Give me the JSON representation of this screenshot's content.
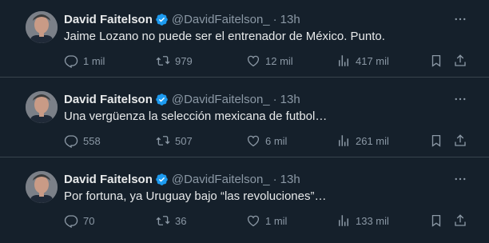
{
  "tweets": [
    {
      "name": "David Faitelson",
      "handle": "@DavidFaitelson_",
      "separator": "·",
      "time": "13h",
      "text": "Jaime Lozano no puede ser el entrenador de México. Punto.",
      "replies": "1 mil",
      "retweets": "979",
      "likes": "12 mil",
      "views": "417 mil"
    },
    {
      "name": "David Faitelson",
      "handle": "@DavidFaitelson_",
      "separator": "·",
      "time": "13h",
      "text": "Una vergüenza la selección mexicana de futbol…",
      "replies": "558",
      "retweets": "507",
      "likes": "6 mil",
      "views": "261 mil"
    },
    {
      "name": "David Faitelson",
      "handle": "@DavidFaitelson_",
      "separator": "·",
      "time": "13h",
      "text": "Por fortuna, ya Uruguay bajo “las revoluciones”…",
      "replies": "70",
      "retweets": "36",
      "likes": "1 mil",
      "views": "133 mil"
    }
  ],
  "colors": {
    "background": "#15202b",
    "text": "#e7e9ea",
    "muted": "#8b98a5",
    "verified": "#1d9bf0",
    "divider": "#38444d"
  },
  "icons": [
    "verified-badge-icon",
    "more-icon",
    "reply-icon",
    "retweet-icon",
    "like-icon",
    "views-icon",
    "bookmark-icon",
    "share-icon"
  ]
}
